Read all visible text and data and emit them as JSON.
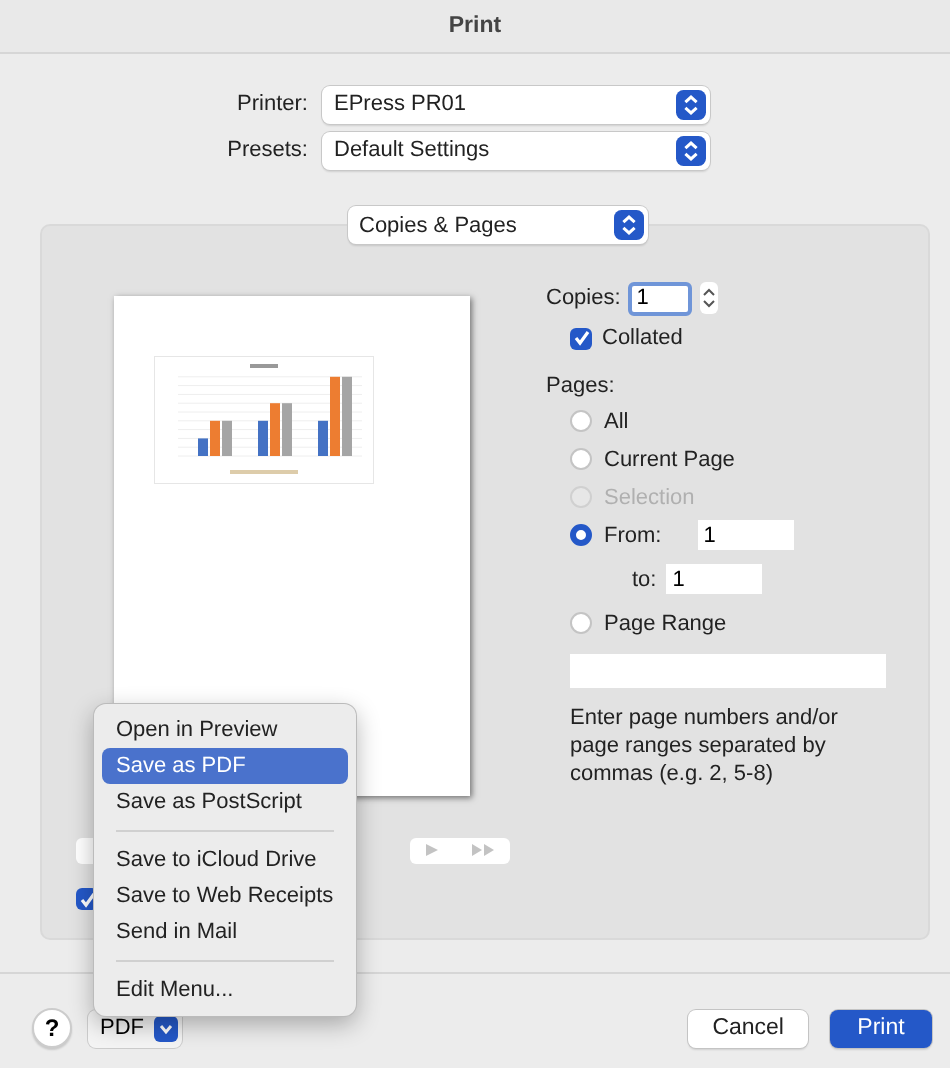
{
  "window": {
    "title": "Print"
  },
  "printer": {
    "label": "Printer:",
    "value": "EPress PR01"
  },
  "presets": {
    "label": "Presets:",
    "value": "Default Settings"
  },
  "section_popup": {
    "value": "Copies & Pages"
  },
  "page_nav": {
    "disabled": true
  },
  "preview_checkbox": {
    "checked": true
  },
  "copies": {
    "label": "Copies:",
    "value": "1"
  },
  "collated": {
    "label": "Collated",
    "checked": true
  },
  "pages": {
    "label": "Pages:",
    "options": [
      {
        "kind": "plain",
        "label": "All",
        "selected": false,
        "disabled": false
      },
      {
        "kind": "plain",
        "label": "Current Page",
        "selected": false,
        "disabled": false
      },
      {
        "kind": "plain",
        "label": "Selection",
        "selected": false,
        "disabled": true
      },
      {
        "kind": "from",
        "label": "From:",
        "selected": true,
        "disabled": false
      },
      {
        "kind": "range",
        "label": "Page Range",
        "selected": false,
        "disabled": false
      }
    ],
    "from": "1",
    "to_label": "to:",
    "to": "1",
    "hint": "Enter page numbers and/or page ranges separated by commas (e.g. 2, 5-8)"
  },
  "menu": {
    "groups": [
      [
        {
          "label": "Open in Preview",
          "selected": false
        },
        {
          "label": "Save as PDF",
          "selected": true
        },
        {
          "label": "Save as PostScript",
          "selected": false
        }
      ],
      [
        {
          "label": "Save to iCloud Drive",
          "selected": false
        },
        {
          "label": "Save to Web Receipts",
          "selected": false
        },
        {
          "label": "Send in Mail",
          "selected": false
        }
      ],
      [
        {
          "label": "Edit Menu...",
          "selected": false
        }
      ]
    ]
  },
  "bottom": {
    "help": "?",
    "pdf": "PDF",
    "cancel": "Cancel",
    "print": "Print"
  }
}
